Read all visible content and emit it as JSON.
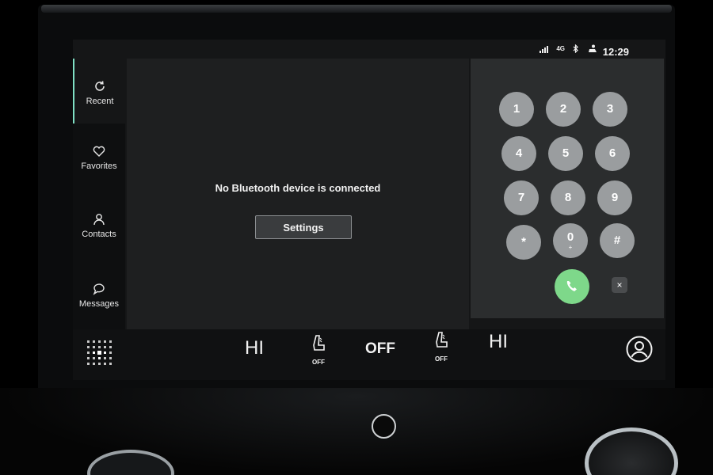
{
  "status": {
    "network_label": "4G",
    "time": "12:29",
    "icons": [
      "signal-bars-icon",
      "network-4g-icon",
      "bluetooth-icon",
      "driver-profile-icon"
    ]
  },
  "sidebar": {
    "items": [
      {
        "label": "Recent",
        "icon": "recent-icon",
        "active": true
      },
      {
        "label": "Favorites",
        "icon": "heart-icon",
        "active": false
      },
      {
        "label": "Contacts",
        "icon": "person-icon",
        "active": false
      },
      {
        "label": "Messages",
        "icon": "speech-bubble-icon",
        "active": false
      }
    ]
  },
  "main": {
    "message": "No Bluetooth device is connected",
    "settings_label": "Settings"
  },
  "keypad": {
    "keys": [
      {
        "label": "1",
        "sub": ""
      },
      {
        "label": "2",
        "sub": ""
      },
      {
        "label": "3",
        "sub": ""
      },
      {
        "label": "4",
        "sub": ""
      },
      {
        "label": "5",
        "sub": ""
      },
      {
        "label": "6",
        "sub": ""
      },
      {
        "label": "7",
        "sub": ""
      },
      {
        "label": "8",
        "sub": ""
      },
      {
        "label": "9",
        "sub": ""
      },
      {
        "label": "*",
        "sub": ""
      },
      {
        "label": "0",
        "sub": "+"
      },
      {
        "label": "#",
        "sub": ""
      }
    ],
    "call_icon": "phone-icon",
    "clear_label": "×"
  },
  "climate": {
    "left_temp": "HI",
    "left_seat_label": "OFF",
    "fan": "OFF",
    "right_seat_label": "OFF",
    "right_temp": "HI"
  },
  "colors": {
    "accent": "#7fe0c4",
    "call_green": "#7ed88a",
    "key_grey": "#9a9d9f"
  }
}
